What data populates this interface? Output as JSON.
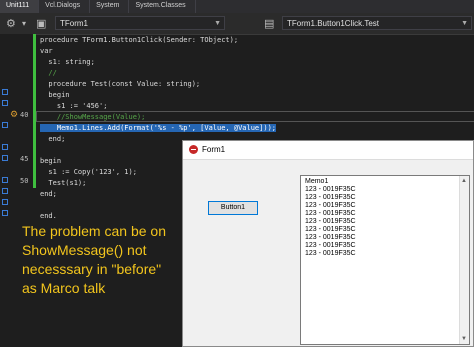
{
  "tabs": [
    "Unit111",
    "Vcl.Dialogs",
    "System",
    "System.Classes"
  ],
  "toolbar": {
    "left_combo": "TForm1",
    "right_combo": "TForm1.Button1Click.Test"
  },
  "gutter": {
    "line_numbers": [
      "40",
      "45",
      "50"
    ]
  },
  "code": [
    "procedure TForm1.Button1Click(Sender: TObject);",
    "var",
    "  s1: string;",
    "  //",
    "  procedure Test(const Value: string);",
    "  begin",
    "    s1 := '456';",
    "    //ShowMessage(Value);",
    "    Memo1.Lines.Add(Format('%s - %p', [Value, @Value]));",
    "  end;",
    "",
    "begin",
    "  s1 := Copy('123', 1);",
    "  Test(s1);",
    "end;",
    "",
    "end."
  ],
  "annotation": "The problem can be on ShowMessage() not necesssary in \"before\" as Marco talk",
  "form": {
    "title": "Form1",
    "button_label": "Button1",
    "memo_lines": [
      "Memo1",
      "123 - 0019F35C",
      "123 - 0019F35C",
      "123 - 0019F35C",
      "123 - 0019F35C",
      "123 - 0019F35C",
      "123 - 0019F35C",
      "123 - 0019F35C",
      "123 - 0019F35C",
      "123 - 0019F35C"
    ]
  },
  "colors": {
    "editor_bg": "#1e1e1e",
    "selection": "#2566b3",
    "change_bar": "#3fbf3f",
    "annotation": "#f2c51d"
  }
}
